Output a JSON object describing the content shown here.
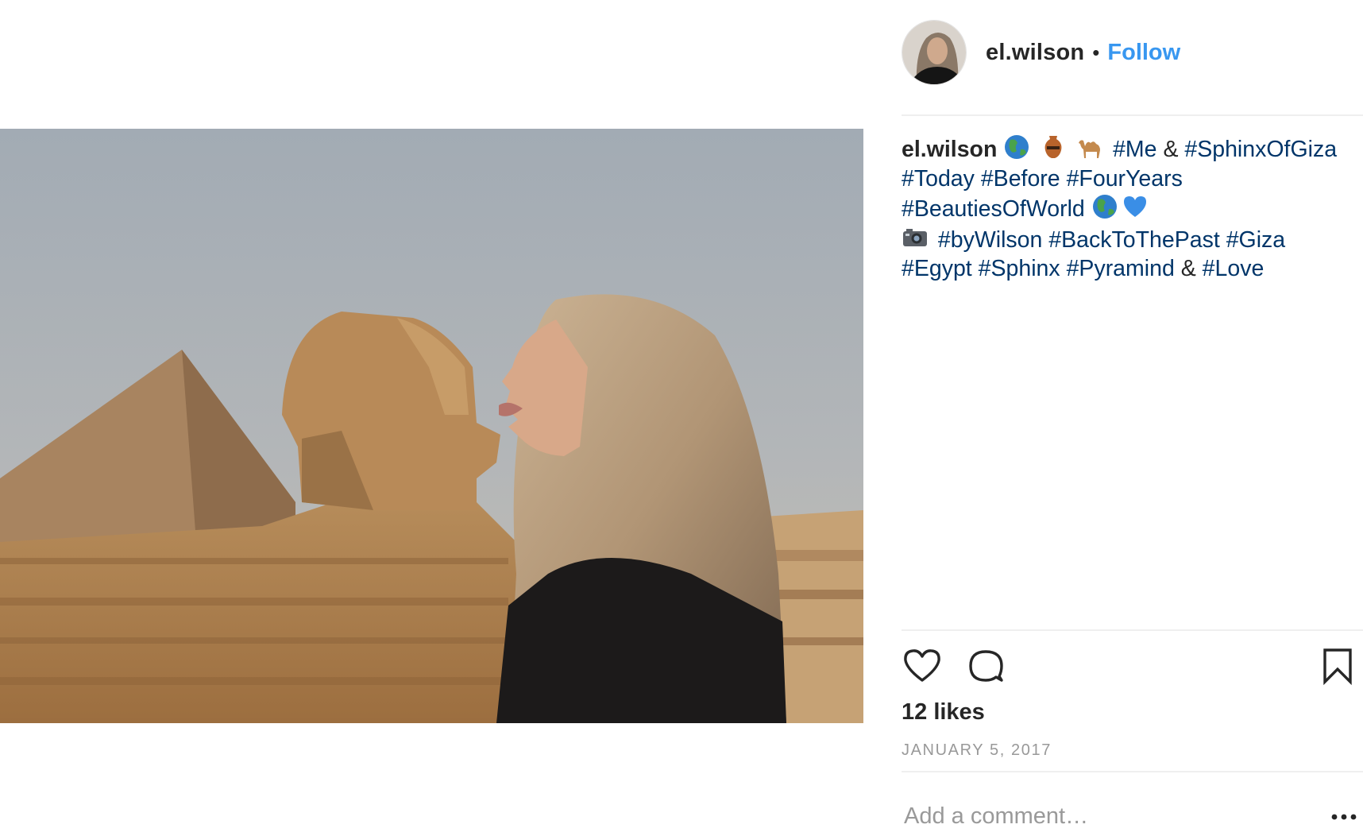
{
  "post": {
    "username": "el.wilson",
    "separator": "•",
    "follow_label": "Follow",
    "avatar_icon": "profile-photo",
    "photo_icon": "photo-sphinx-kiss",
    "caption": {
      "username": "el.wilson",
      "line1": [
        "#Me",
        "&",
        "#SphinxOfGiza"
      ],
      "line2": [
        "#Today",
        "#Before",
        "#FourYears"
      ],
      "line3": [
        "#BeautiesOfWorld"
      ],
      "line4": [
        "#byWilson",
        "#BackToThePast",
        "#Giza"
      ],
      "line5": [
        "#Egypt",
        "#Sphinx",
        "#Pyramind",
        "&",
        "#Love"
      ],
      "emoji_names": [
        "globe-emoji",
        "amphora-emoji",
        "camel-emoji",
        "globe-emoji",
        "blue-heart-emoji",
        "camera-emoji"
      ]
    },
    "likes_text": "12 likes",
    "date_text": "JANUARY 5, 2017",
    "comment_placeholder": "Add a comment…"
  },
  "colors": {
    "link": "#3897f0",
    "hashtag": "#003569",
    "text": "#262626",
    "muted": "#999999",
    "divider": "#efefef"
  },
  "icons": {
    "like": "heart-icon",
    "comment": "comment-icon",
    "save": "bookmark-icon",
    "more": "more-options-icon"
  }
}
